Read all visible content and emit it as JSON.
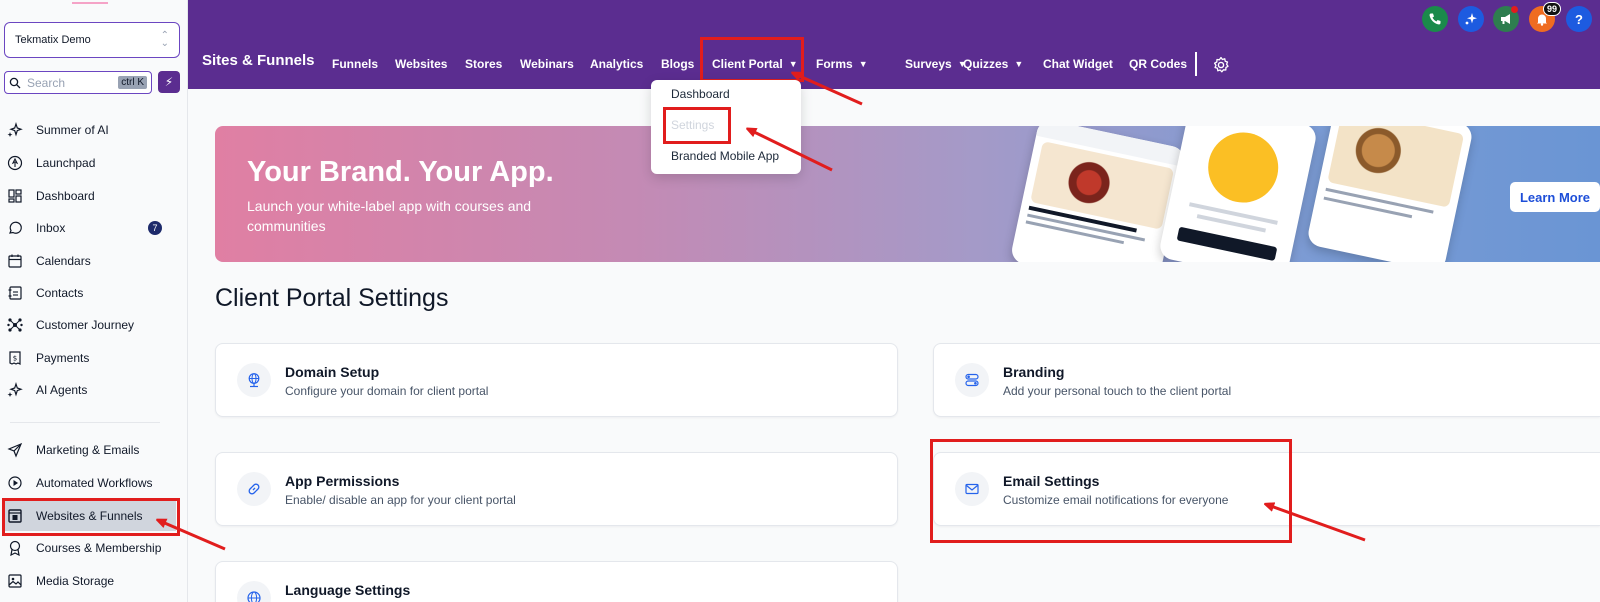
{
  "sidebar": {
    "account": "Tekmatix Demo",
    "search_placeholder": "Search",
    "search_shortcut": "ctrl K",
    "items": [
      {
        "label": "Summer of AI",
        "icon": "sparkle-icon"
      },
      {
        "label": "Launchpad",
        "icon": "rocket-icon"
      },
      {
        "label": "Dashboard",
        "icon": "grid-icon"
      },
      {
        "label": "Inbox",
        "icon": "chat-icon",
        "badge": "7"
      },
      {
        "label": "Calendars",
        "icon": "calendar-icon"
      },
      {
        "label": "Contacts",
        "icon": "contacts-icon"
      },
      {
        "label": "Customer Journey",
        "icon": "network-icon"
      },
      {
        "label": "Payments",
        "icon": "payments-icon"
      },
      {
        "label": "AI Agents",
        "icon": "sparkle-icon"
      },
      {
        "label": "Marketing & Emails",
        "icon": "send-icon"
      },
      {
        "label": "Automated Workflows",
        "icon": "workflow-icon"
      },
      {
        "label": "Websites & Funnels",
        "icon": "website-icon"
      },
      {
        "label": "Courses & Membership",
        "icon": "award-icon"
      },
      {
        "label": "Media Storage",
        "icon": "image-icon"
      }
    ]
  },
  "topbar": {
    "section_title": "Sites & Funnels",
    "nav": [
      {
        "label": "Funnels",
        "dropdown": false
      },
      {
        "label": "Websites",
        "dropdown": false
      },
      {
        "label": "Stores",
        "dropdown": false
      },
      {
        "label": "Webinars",
        "dropdown": false
      },
      {
        "label": "Analytics",
        "dropdown": false
      },
      {
        "label": "Blogs",
        "dropdown": false
      },
      {
        "label": "Client Portal",
        "dropdown": true
      },
      {
        "label": "Forms",
        "dropdown": true
      },
      {
        "label": "Surveys",
        "dropdown": true
      },
      {
        "label": "Quizzes",
        "dropdown": true
      },
      {
        "label": "Chat Widget",
        "dropdown": false
      },
      {
        "label": "QR Codes",
        "dropdown": false
      }
    ],
    "notifications_count": "99",
    "help_label": "?"
  },
  "dropdown": {
    "items": [
      "Dashboard",
      "Settings",
      "Branded Mobile App"
    ]
  },
  "banner": {
    "title": "Your Brand. Your App.",
    "subtitle": "Launch your white-label app with courses and communities",
    "button": "Learn More"
  },
  "main": {
    "title": "Client Portal Settings",
    "cards": [
      {
        "title": "Domain Setup",
        "desc": "Configure your domain for client portal",
        "icon": "globe-network-icon"
      },
      {
        "title": "Branding",
        "desc": "Add your personal touch to the client portal",
        "icon": "toggle-icon"
      },
      {
        "title": "App Permissions",
        "desc": "Enable/ disable an app for your client portal",
        "icon": "link-icon"
      },
      {
        "title": "Email Settings",
        "desc": "Customize email notifications for everyone",
        "icon": "mail-icon"
      },
      {
        "title": "Language Settings",
        "desc": "",
        "icon": "globe-icon"
      }
    ]
  },
  "colors": {
    "topbar": "#5b2d90",
    "highlight": "#e11d1d",
    "phone_green": "#1b8a4b",
    "blue": "#1d4ed8",
    "orange": "#ef6c20"
  }
}
